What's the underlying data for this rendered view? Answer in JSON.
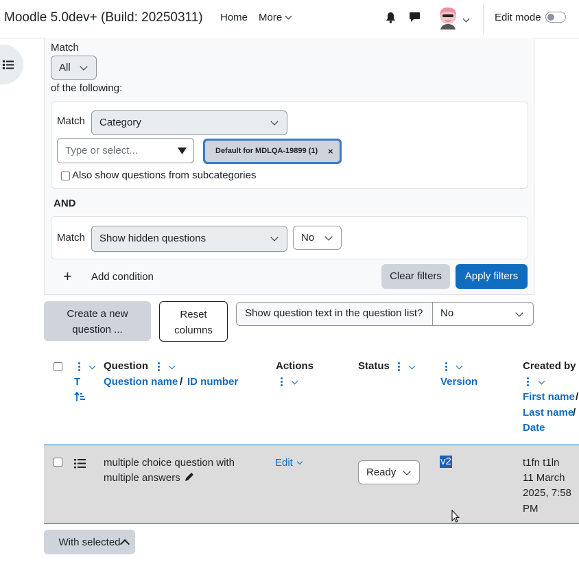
{
  "navbar": {
    "brand": "Moodle 5.0dev+ (Build: 20250311)",
    "home": "Home",
    "more": "More",
    "edit_mode": "Edit mode"
  },
  "filters": {
    "match_label": "Match",
    "match_value": "All",
    "of_following": "of the following:",
    "cond1": {
      "match_label": "Match",
      "type_value": "Category",
      "type_placeholder": "Type or select...",
      "selected_chip": "Default for MDLQA-19899 (1)",
      "chip_remove": "×",
      "subcategories_label": "Also show questions from subcategories"
    },
    "join_label": "AND",
    "cond2": {
      "match_label": "Match",
      "type_value": "Show hidden questions",
      "value": "No"
    },
    "add_condition": "Add condition",
    "add_icon": "+",
    "clear": "Clear filters",
    "apply": "Apply filters"
  },
  "toolbar": {
    "create_line1": "Create a new",
    "create_line2": "question ...",
    "reset_line1": "Reset",
    "reset_line2": "columns",
    "show_text_label": "Show question text in the question list?",
    "show_text_value": "No"
  },
  "table": {
    "headers": {
      "type_short": "T",
      "question": "Question",
      "question_name": "Question name",
      "slash": "/",
      "id_number": "ID number",
      "actions": "Actions",
      "status": "Status",
      "version": "Version",
      "created_by": "Created by",
      "first_name": "First name",
      "last_name": "Last name",
      "date": "Date"
    },
    "rows": [
      {
        "name_line1": "multiple choice question with",
        "name_line2": "multiple answers",
        "action": "Edit",
        "status": "Ready",
        "version": "v2",
        "creator": "t1fn t1ln",
        "date_line1": "11 March",
        "date_line2": "2025, 7:58",
        "date_line3": "PM"
      }
    ]
  },
  "bulk": {
    "with_selected": "With selected"
  }
}
